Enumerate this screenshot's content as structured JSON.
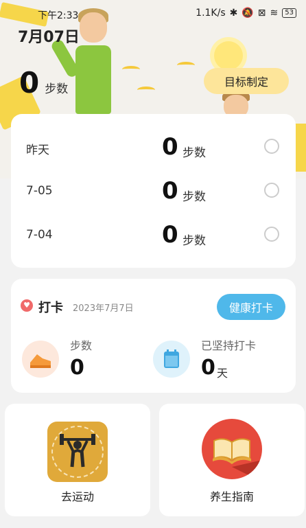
{
  "status_bar": {
    "time": "下午2:33",
    "network_speed": "1.1K/s",
    "battery": "53"
  },
  "header": {
    "date": "7月07日",
    "today_steps": "0",
    "steps_unit": "步数",
    "goal_button": "目标制定"
  },
  "history": [
    {
      "label": "昨天",
      "value": "0",
      "unit": "步数"
    },
    {
      "label": "7-05",
      "value": "0",
      "unit": "步数"
    },
    {
      "label": "7-04",
      "value": "0",
      "unit": "步数"
    }
  ],
  "checkin": {
    "title": "打卡",
    "date": "2023年7月7日",
    "health_button": "健康打卡",
    "steps_label": "步数",
    "steps_value": "0",
    "streak_label": "已坚持打卡",
    "streak_value": "0",
    "streak_unit": "天"
  },
  "tiles": {
    "sport": "去运动",
    "guide": "养生指南"
  },
  "colors": {
    "accent_yellow": "#fde59a",
    "accent_blue": "#4fb8ea",
    "heart_red": "#f06a6a"
  }
}
